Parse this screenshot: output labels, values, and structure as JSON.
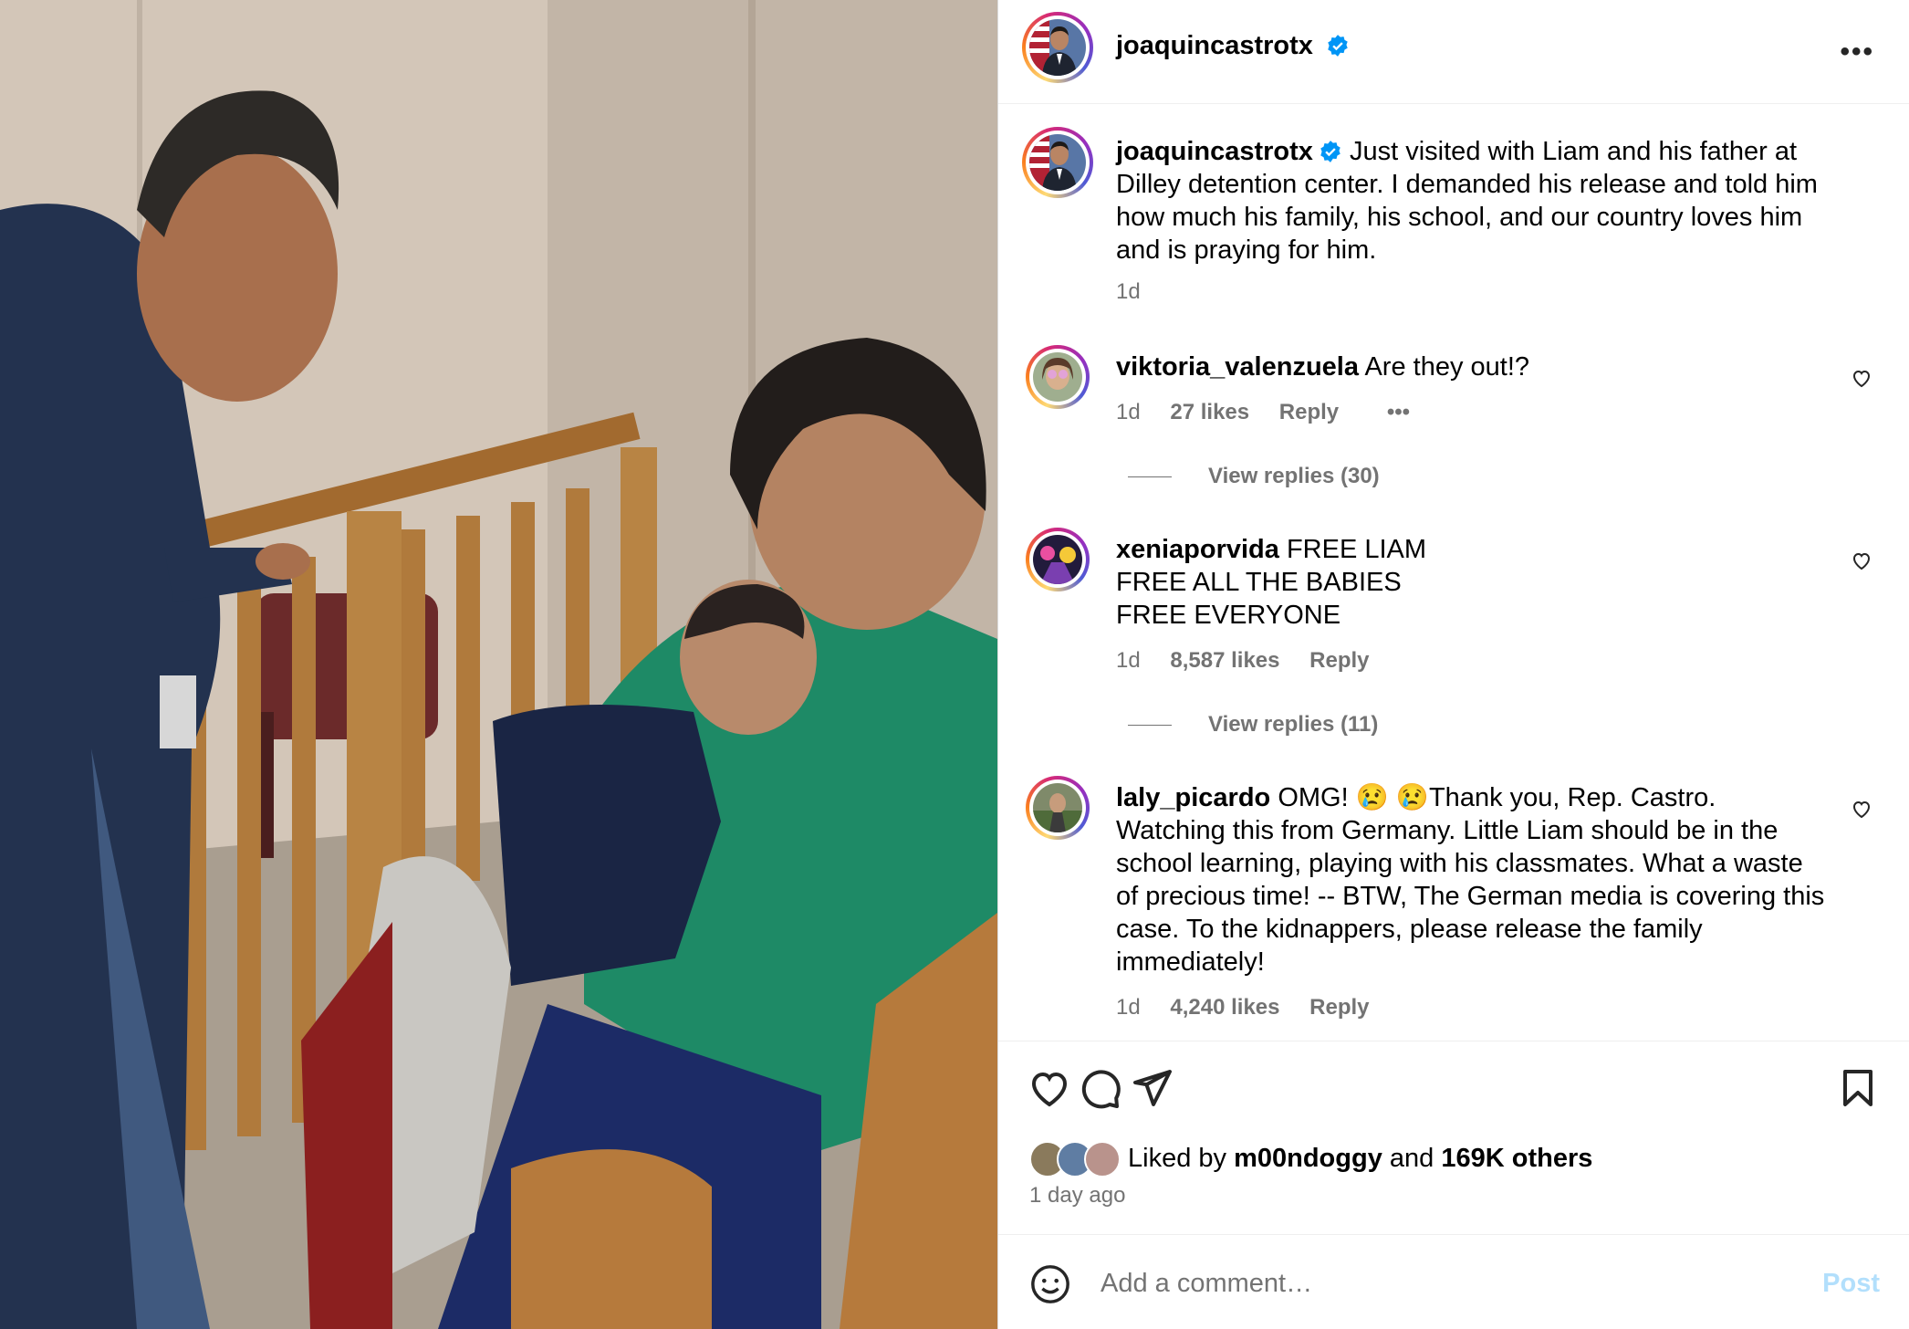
{
  "post": {
    "username": "joaquincastrotx",
    "caption": "Just visited with Liam and his father at Dilley detention center. I demanded his release and told him how much his family, his school, and our country loves him and is praying for him.",
    "caption_time": "1d"
  },
  "comments": [
    {
      "username": "viktoria_valenzuela",
      "text": "Are they out!?",
      "time": "1d",
      "likes": "27 likes",
      "reply": "Reply",
      "replies": "View replies (30)"
    },
    {
      "username": "xeniaporvida",
      "text": "FREE LIAM\nFREE ALL THE BABIES\nFREE EVERYONE",
      "time": "1d",
      "likes": "8,587 likes",
      "reply": "Reply",
      "replies": "View replies (11)"
    },
    {
      "username": "laly_picardo",
      "text": "OMG! 😢 😢Thank you, Rep. Castro. Watching this from Germany. Little Liam should be in the school learning, playing with his classmates. What a waste of precious time! -- BTW, The German media is covering this case. To the kidnappers, please release the family immediately!",
      "time": "1d",
      "likes": "4,240 likes",
      "reply": "Reply"
    }
  ],
  "likes": {
    "prefix": "Liked by",
    "user": "m00ndoggy",
    "joiner": "and",
    "others": "169K others"
  },
  "time_ago": "1 day ago",
  "composer": {
    "placeholder": "Add a comment…",
    "post_label": "Post"
  },
  "icons": [
    "more-icon",
    "verified-badge-icon",
    "heart-icon",
    "comment-icon",
    "share-icon",
    "bookmark-icon",
    "emoji-icon"
  ],
  "colors": {
    "verified": "#0095f6",
    "post_disabled": "#b2dffc",
    "muted": "#737373"
  }
}
